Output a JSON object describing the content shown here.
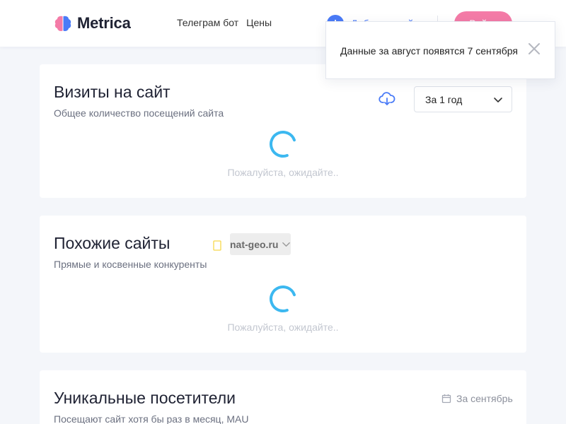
{
  "header": {
    "logo_text": "Metrica",
    "nav": [
      "Телеграм бот",
      "Цены"
    ],
    "add_site_label": "Добавить сайт",
    "login_label": "Войти"
  },
  "toast": {
    "message": "Данные за август появятся 7 сентября"
  },
  "visits_card": {
    "title": "Визиты на сайт",
    "subtitle": "Общее количество посещений сайта",
    "period_value": "За 1 год",
    "loading_text": "Пожалуйста, ожидайте.."
  },
  "similar_card": {
    "title": "Похожие сайты",
    "subtitle": "Прямые и косвенные конкуренты",
    "site_value": "nat-geo.ru",
    "loading_text": "Пожалуйста, ожидайте.."
  },
  "unique_card": {
    "title": "Уникальные посетители",
    "subtitle": "Посещают сайт хотя бы раз в месяц, MAU",
    "month_label": "За сентябрь"
  },
  "colors": {
    "accent": "#4a7bf7",
    "login": "#f47ba7",
    "spinner": "#3cb8f0",
    "background": "#f4f6fa"
  }
}
